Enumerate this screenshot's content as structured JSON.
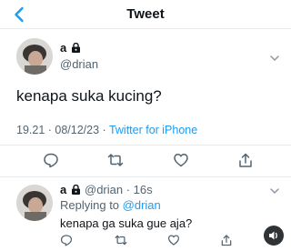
{
  "header": {
    "title": "Tweet"
  },
  "tweet": {
    "author_name": "a",
    "handle": "@drian",
    "text": "kenapa suka kucing?",
    "time_date": "19.21 · 08/12/23 · ",
    "source": "Twitter for iPhone"
  },
  "reply": {
    "author_name": "a",
    "handle_time": "@drian · 16s",
    "replying_prefix": "Replying to ",
    "replying_to": "@drian",
    "text": "kenapa ga suka gue aja?"
  },
  "colors": {
    "accent": "#1d9bf0",
    "muted": "#536471",
    "text": "#0f1419",
    "divider": "#e6ecf0"
  }
}
